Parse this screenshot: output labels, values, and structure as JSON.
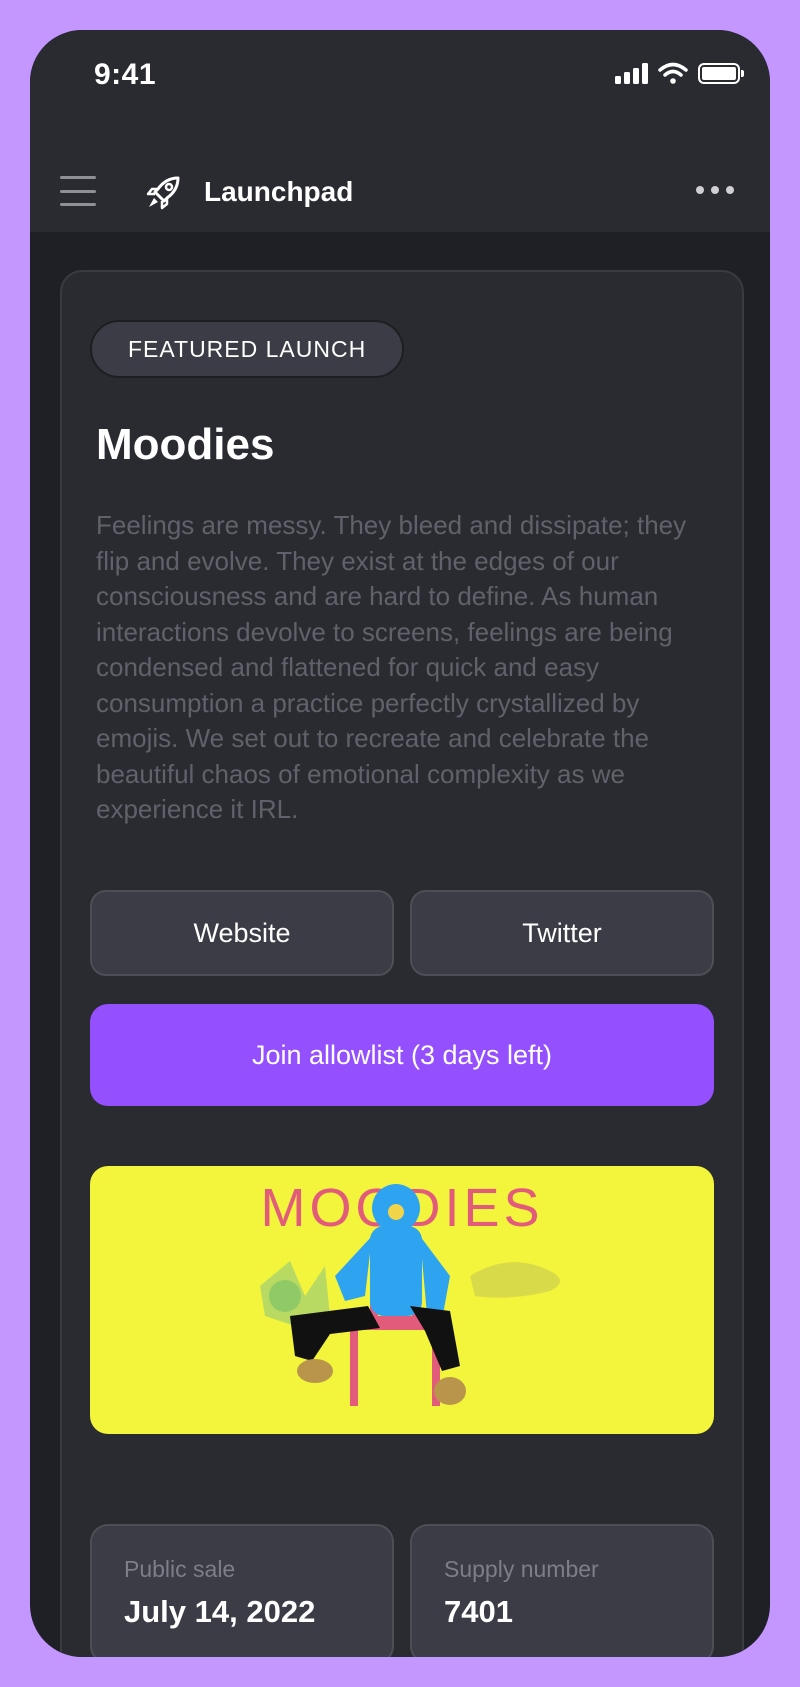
{
  "status_bar": {
    "time": "9:41",
    "icons": [
      "cellular-signal-icon",
      "wifi-icon",
      "battery-icon"
    ]
  },
  "header": {
    "app_name": "Launchpad",
    "icons": {
      "menu": "hamburger-menu-icon",
      "logo": "rocket-icon",
      "more": "more-dots-icon"
    }
  },
  "card": {
    "badge": "FEATURED LAUNCH",
    "title": "Moodies",
    "description": "Feelings are messy. They bleed and dissipate; they flip and evolve. They exist at the edges of our consciousness and are hard to define. As human interactions devolve to screens, feelings are being condensed and flattened for quick and easy consumption a practice perfectly crystallized by emojis. We set out to recreate and celebrate the beautiful chaos of emotional complexity as we experience it IRL.",
    "buttons": {
      "website": "Website",
      "twitter": "Twitter",
      "allowlist": "Join allowlist (3 days left)"
    },
    "artwork": {
      "wordmark": "MOODIES"
    },
    "stats": [
      {
        "label": "Public sale",
        "value": "July 14, 2022"
      },
      {
        "label": "Supply number",
        "value": "7401"
      }
    ]
  },
  "colors": {
    "frame": "#c397ff",
    "background": "#1f2025",
    "surface": "#2a2b31",
    "button": "#3b3c45",
    "accent": "#9450ff",
    "artwork_background": "#f2f53c",
    "artwork_wordmark": "#e35b7a",
    "description_text": "#60616a"
  }
}
